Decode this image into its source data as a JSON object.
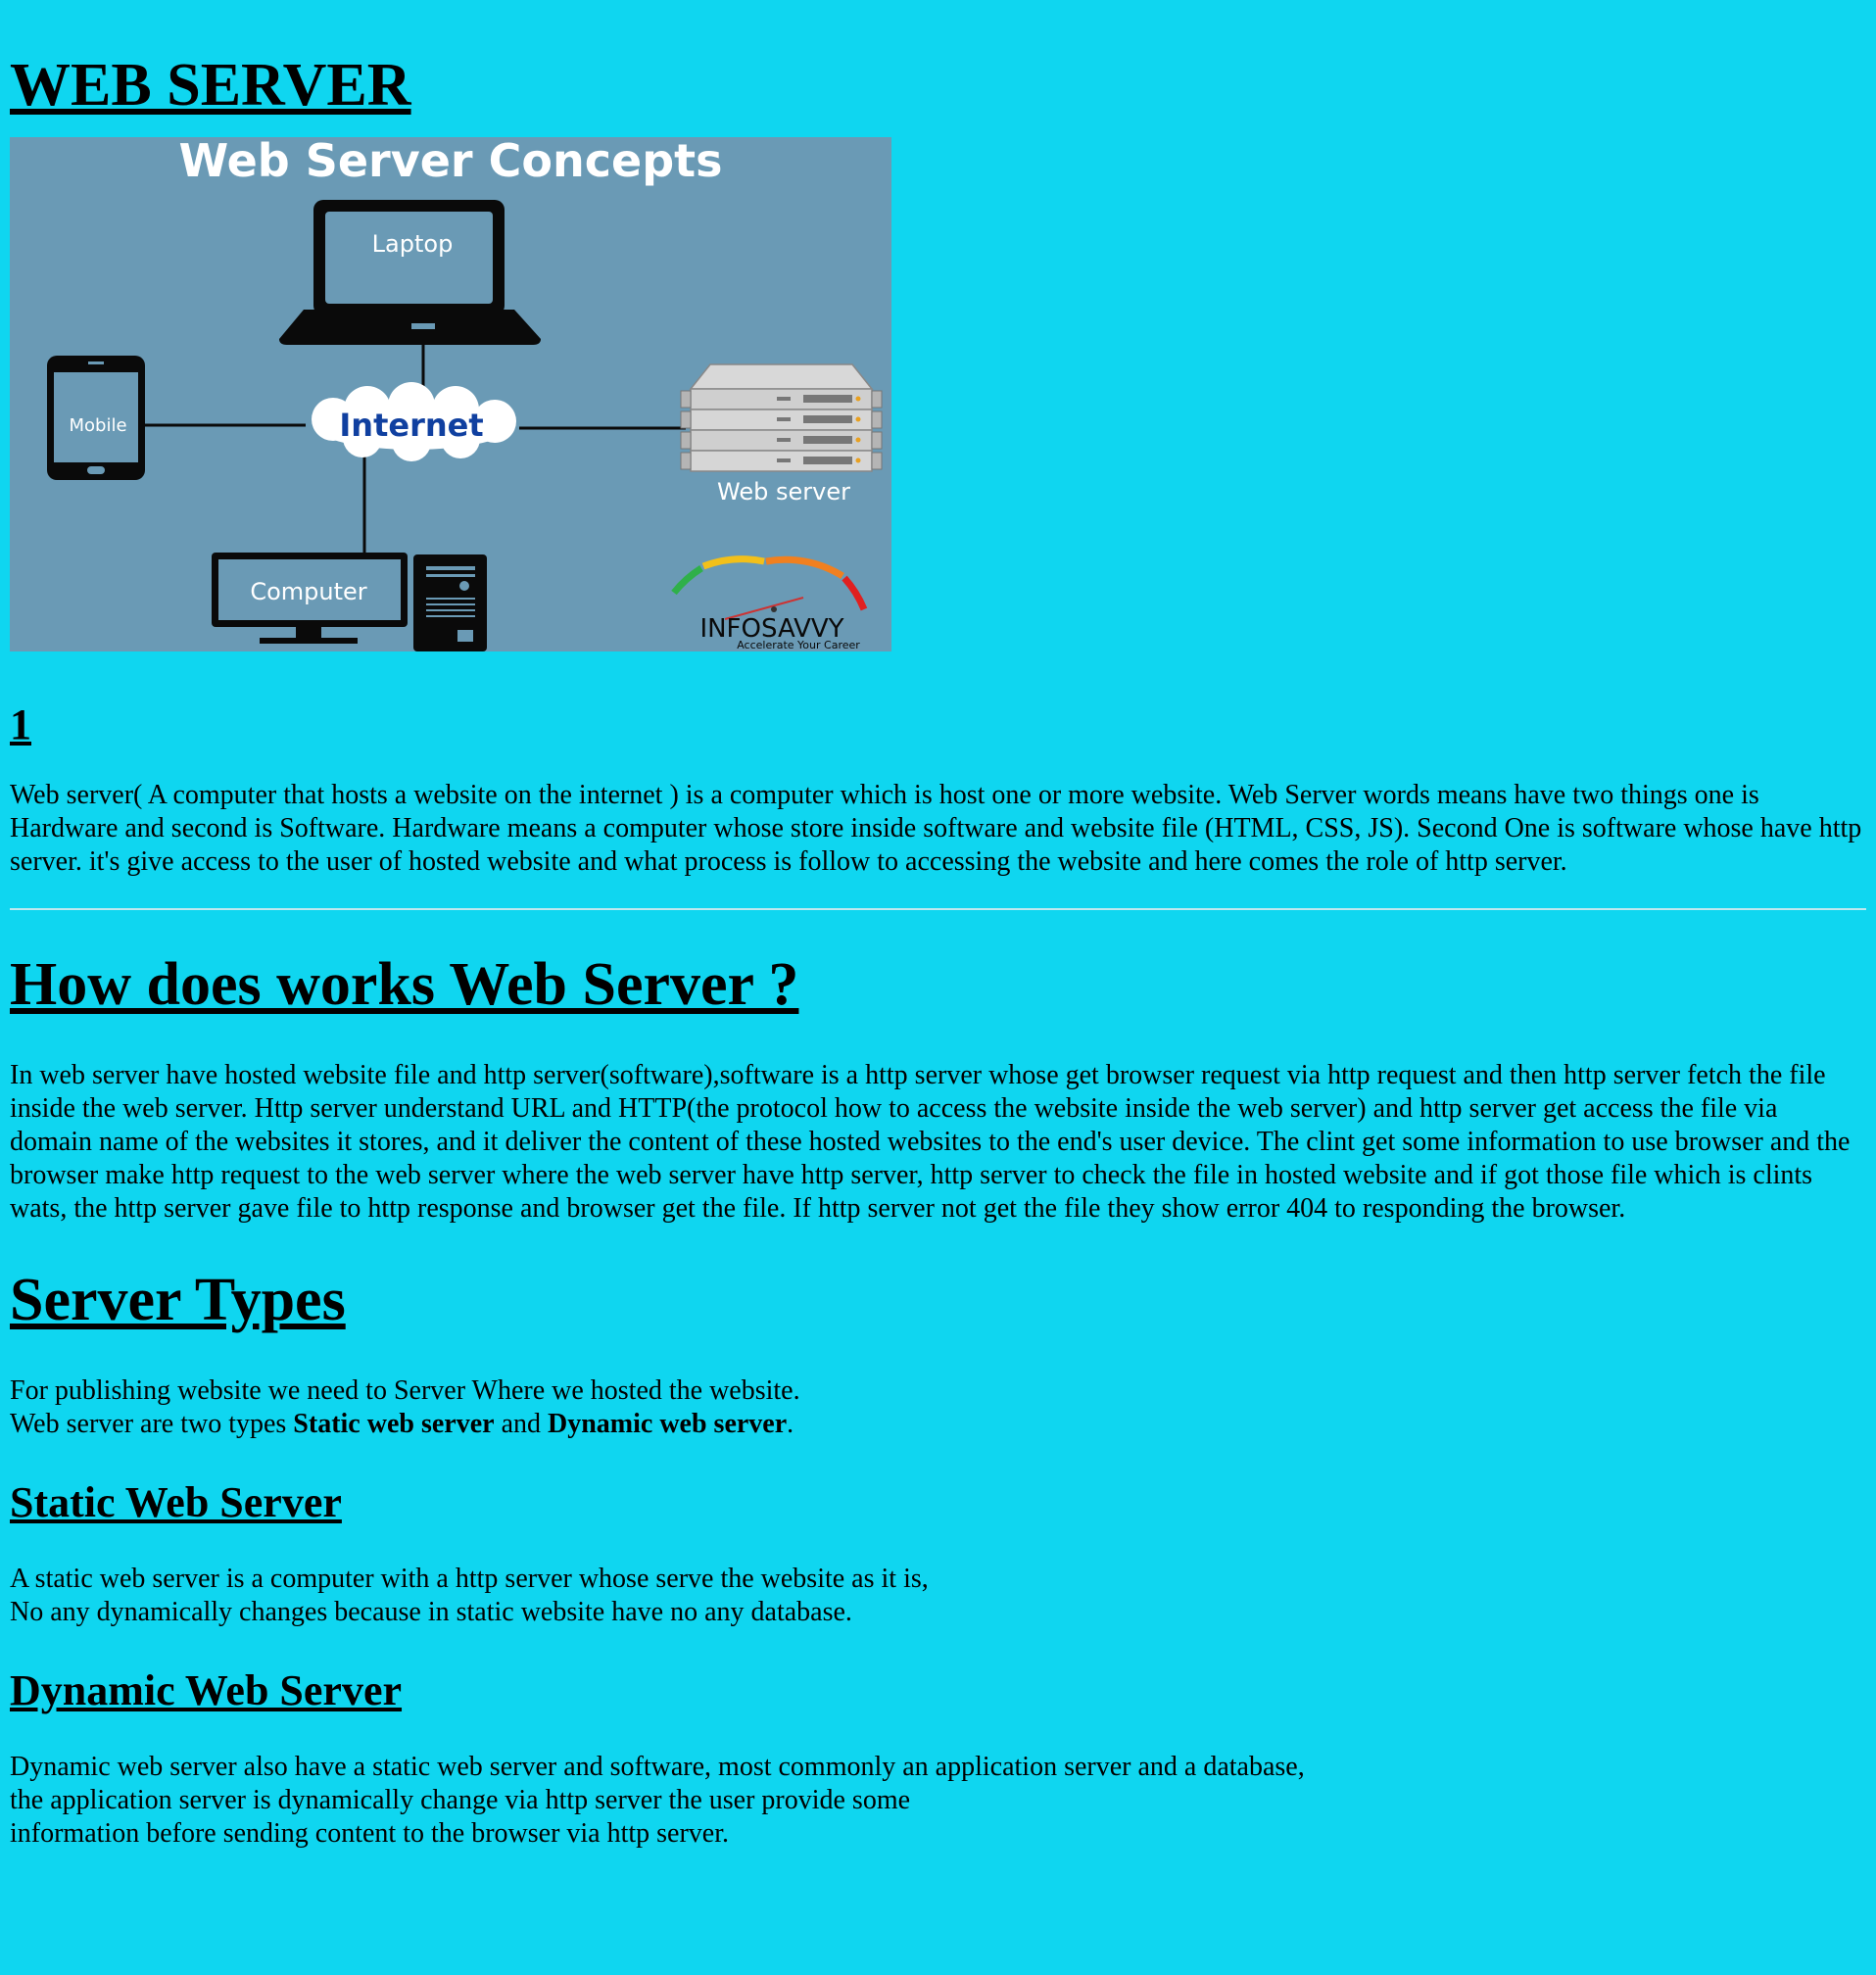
{
  "title": "WEB SERVER",
  "figure": {
    "heading": "Web Server Concepts",
    "laptop": "Laptop",
    "mobile": "Mobile",
    "internet": "Internet",
    "webserver": "Web server",
    "computer": "Computer",
    "brand": "INFOSAVVY",
    "tagline": "Accelerate Your Career",
    "colors": {
      "bg": "#6a9ab5",
      "line": "#0a0a0a",
      "internet_text": "#1040a0"
    }
  },
  "section1": {
    "heading": "1",
    "para": "Web server( A computer that hosts a website on the internet ) is a computer which is host one or more website. Web Server words means have two things one is Hardware and second is Software. Hardware means a computer whose store inside software and website file (HTML, CSS, JS). Second One is software whose have http server. it's give access to the user of hosted website and what process is follow to accessing the website and here comes the role of http server."
  },
  "how": {
    "heading": "How does works Web Server ?",
    "para": "In web server have hosted website file and http server(software),software is a http server whose get browser request via http request and then http server fetch the file inside the web server. Http server understand URL and HTTP(the protocol how to access the website inside the web server) and http server get access the file via domain name of the websites it stores, and it deliver the content of these hosted websites to the end's user device. The clint get some information to use browser and the browser make http request to the web server where the web server have http server, http server to check the file in hosted website and if got those file which is clints wats, the http server gave file to http response and browser get the file. If http server not get the file they show error 404 to responding the browser."
  },
  "types": {
    "heading": "Server Types",
    "line1": "For publishing website we need to Server Where we hosted the website.",
    "line2_prefix": "Web server are two types ",
    "static_bold": "Static web server",
    "and": " and ",
    "dynamic_bold": "Dynamic web server",
    "period": "."
  },
  "static": {
    "heading": "Static Web Server",
    "line1": "A static web server is a computer with a http server whose serve the website as it is,",
    "line2": "No any dynamically changes because in static website have no any database."
  },
  "dynamic": {
    "heading": "Dynamic Web Server",
    "line1": "Dynamic web server also have a static web server and software, most commonly an application server and a database,",
    "line2": "the application server is dynamically change via http server the user provide some",
    "line3": "information before sending content to the browser via http server."
  }
}
